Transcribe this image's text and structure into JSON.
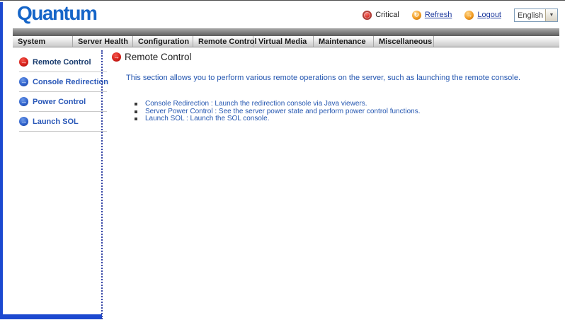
{
  "header": {
    "logo": "Quantum",
    "critical_label": "Critical",
    "refresh_label": "Refresh",
    "logout_label": "Logout",
    "language_selected": "English"
  },
  "icons": {
    "arrow": "→",
    "refresh": "↻",
    "logout": "→",
    "dropdown": "▼"
  },
  "navbar": {
    "items": [
      {
        "label": "System"
      },
      {
        "label": "Server Health"
      },
      {
        "label": "Configuration"
      },
      {
        "label": "Remote Control"
      },
      {
        "label": "Virtual Media"
      },
      {
        "label": "Maintenance"
      },
      {
        "label": "Miscellaneous"
      }
    ]
  },
  "sidebar": {
    "items": [
      {
        "label": "Remote Control",
        "active": true
      },
      {
        "label": "Console Redirection",
        "active": false
      },
      {
        "label": "Power Control",
        "active": false
      },
      {
        "label": "Launch SOL",
        "active": false
      }
    ]
  },
  "main": {
    "title": "Remote Control",
    "description": "This section allows you to perform various remote operations on the server, such as launching the remote console.",
    "bullets": [
      "Console Redirection : Launch the redirection console via Java viewers.",
      "Server Power Control : See the server power state and perform power control functions.",
      "Launch SOL : Launch the SOL console."
    ]
  },
  "colors": {
    "accent_blue": "#1c49d0",
    "logo_blue": "#1565c8",
    "link_blue": "#1e3a9e",
    "body_text_blue": "#2456b0",
    "active_icon_red": "#d6201a",
    "icon_blue": "#2f62cc",
    "icon_orange": "#f29a1f"
  }
}
